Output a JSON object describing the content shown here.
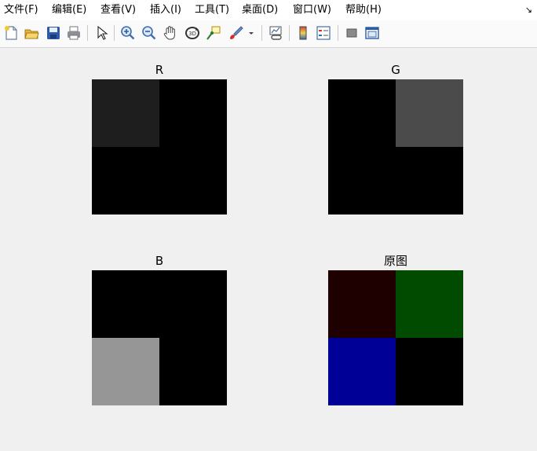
{
  "menu": {
    "items": [
      "文件(F)",
      "编辑(E)",
      "查看(V)",
      "插入(I)",
      "工具(T)",
      "桌面(D)",
      "窗口(W)",
      "帮助(H)"
    ],
    "overflow_icon": "dock-arrow-icon"
  },
  "toolbar": {
    "icons": [
      "new-figure-icon",
      "open-file-icon",
      "save-icon",
      "print-icon",
      "select-arrow-icon",
      "zoom-in-icon",
      "zoom-out-icon",
      "pan-hand-icon",
      "rotate-3d-icon",
      "data-cursor-icon",
      "brush-icon",
      "link-plot-icon",
      "colorbar-icon",
      "legend-icon",
      "hide-plot-tools-icon",
      "show-plot-tools-icon"
    ]
  },
  "subplots": [
    {
      "title": "R",
      "pixels": [
        [
          "#1e1e1e",
          "#000000"
        ],
        [
          "#000000",
          "#000000"
        ]
      ]
    },
    {
      "title": "G",
      "pixels": [
        [
          "#000000",
          "#4b4b4b"
        ],
        [
          "#000000",
          "#000000"
        ]
      ]
    },
    {
      "title": "B",
      "pixels": [
        [
          "#000000",
          "#000000"
        ],
        [
          "#969696",
          "#000000"
        ]
      ]
    },
    {
      "title": "原图",
      "pixels": [
        [
          "#1e0000",
          "#004b00"
        ],
        [
          "#000096",
          "#000000"
        ]
      ]
    }
  ]
}
